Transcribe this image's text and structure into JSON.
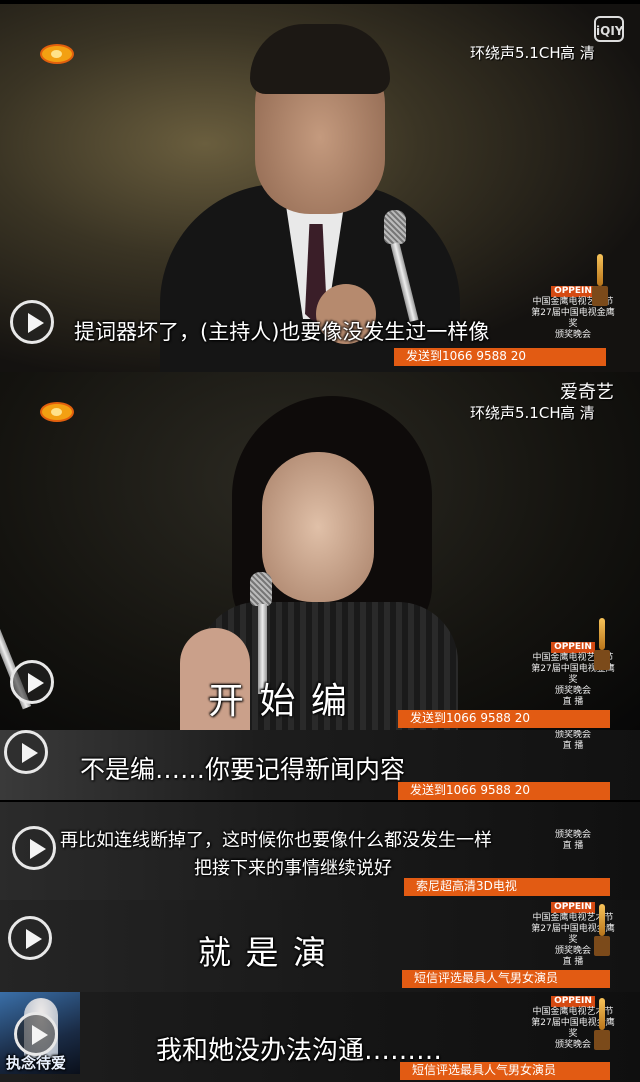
{
  "panels": [
    {
      "id": "panel1",
      "subtitle": "提词器坏了，(主持人)也要像没发生过一样像",
      "hud": {
        "audio": "环绕声5.1CH",
        "quality": "高 清",
        "brand": "iQIY"
      },
      "banner": "发送到1066 9588 20",
      "award": {
        "brand": "OPPEIN",
        "line1": "中国金鹰电视艺术节",
        "line2": "第27届中国电视金鹰奖",
        "line3": "颁奖晚会"
      }
    },
    {
      "id": "panel2",
      "subtitle": "开  始  编",
      "hud": {
        "audio": "环绕声5.1CH",
        "quality": "高 清",
        "brand": "爱奇艺"
      },
      "banner": "发送到1066 9588 20",
      "award": {
        "brand": "OPPEIN",
        "line1": "中国金鹰电视艺术节",
        "line2": "第27届中国电视金鹰奖",
        "line3": "颁奖晚会",
        "line4": "直 播"
      }
    },
    {
      "id": "panel3",
      "subtitle": "不是编……你要记得新闻内容",
      "banner": "发送到1066 9588 20",
      "award": {
        "line3": "颁奖晚会",
        "line4": "直 播"
      }
    },
    {
      "id": "panel4",
      "subtitle_line1": "再比如连线断掉了，这时候你也要像什么都没发生一样",
      "subtitle_line2": "把接下来的事情继续说好",
      "banner": "索尼超高清3D电视",
      "award": {
        "line3": "颁奖晚会",
        "line4": "直 播"
      }
    },
    {
      "id": "panel5",
      "subtitle": "就  是  演",
      "banner": "短信评选最具人气男女演员",
      "award": {
        "brand": "OPPEIN",
        "line1": "中国金鹰电视艺术节",
        "line2": "第27届中国电视金鹰奖",
        "line3": "颁奖晚会",
        "line4": "直 播"
      }
    },
    {
      "id": "panel6",
      "subtitle": "我和她没办法沟通………",
      "banner": "短信评选最具人气男女演员",
      "award": {
        "brand": "OPPEIN",
        "line1": "中国金鹰电视艺术节",
        "line2": "第27届中国电视金鹰奖",
        "line3": "颁奖晚会"
      },
      "thumb_caption": "执念待爱"
    }
  ],
  "colors": {
    "banner": "#e25b13",
    "accent": "#f3a012"
  }
}
